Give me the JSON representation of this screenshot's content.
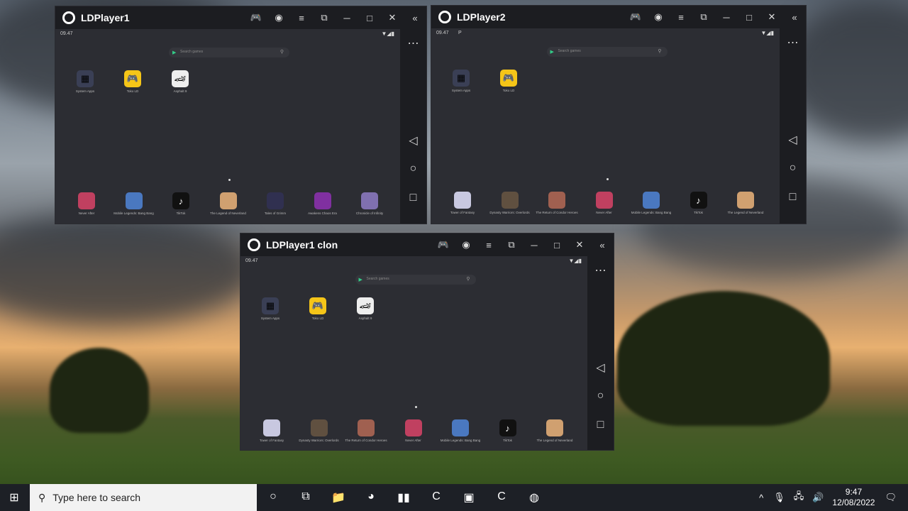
{
  "windows": [
    {
      "title": "LDPlayer1",
      "time": "09.47",
      "status_extra": "",
      "search_placeholder": "Search games",
      "top_apps": [
        {
          "label": "System Apps",
          "icon": "grid-apps-icon",
          "color": "#3a3f55"
        },
        {
          "label": "Toko LD",
          "icon": "gamepad-icon",
          "color": "#f5c518"
        },
        {
          "label": "Asphalt 9",
          "icon": "car-icon",
          "color": "#eeeeee"
        }
      ],
      "dock_apps": [
        {
          "label": "Never After",
          "color": "#c04060"
        },
        {
          "label": "Mobile Legends: Bang Bang",
          "color": "#4a78c0"
        },
        {
          "label": "TikTok",
          "color": "#111111"
        },
        {
          "label": "The Legend of Neverland",
          "color": "#d0a070"
        },
        {
          "label": "Tales of Grimm",
          "color": "#303050"
        },
        {
          "label": "Awakens Chaos Era",
          "color": "#8030a0"
        },
        {
          "label": "Chronicle of Infinity",
          "color": "#8070b0"
        }
      ]
    },
    {
      "title": "LDPlayer2",
      "time": "09.47",
      "status_extra": "P",
      "search_placeholder": "Search games",
      "top_apps": [
        {
          "label": "System Apps",
          "icon": "grid-apps-icon",
          "color": "#3a3f55"
        },
        {
          "label": "Toko LD",
          "icon": "gamepad-icon",
          "color": "#f5c518"
        }
      ],
      "dock_apps": [
        {
          "label": "Tower of Fantasy",
          "color": "#c8c8e0"
        },
        {
          "label": "Dynasty Warriors: Overlords",
          "color": "#605040"
        },
        {
          "label": "The Return of Condor Heroes",
          "color": "#a06050"
        },
        {
          "label": "Never After",
          "color": "#c04060"
        },
        {
          "label": "Mobile Legends: Bang Bang",
          "color": "#4a78c0"
        },
        {
          "label": "TikTok",
          "color": "#111111"
        },
        {
          "label": "The Legend of Neverland",
          "color": "#d0a070"
        }
      ]
    },
    {
      "title": "LDPlayer1 clon",
      "time": "09.47",
      "status_extra": "",
      "search_placeholder": "Search games",
      "top_apps": [
        {
          "label": "System Apps",
          "icon": "grid-apps-icon",
          "color": "#3a3f55"
        },
        {
          "label": "Toko LD",
          "icon": "gamepad-icon",
          "color": "#f5c518"
        },
        {
          "label": "Asphalt 9",
          "icon": "car-icon",
          "color": "#eeeeee"
        }
      ],
      "dock_apps": [
        {
          "label": "Tower of Fantasy",
          "color": "#c8c8e0"
        },
        {
          "label": "Dynasty Warriors: Overlords",
          "color": "#605040"
        },
        {
          "label": "The Return of Condor Heroes",
          "color": "#a06050"
        },
        {
          "label": "Never After",
          "color": "#c04060"
        },
        {
          "label": "Mobile Legends: Bang Bang",
          "color": "#4a78c0"
        },
        {
          "label": "TikTok",
          "color": "#111111"
        },
        {
          "label": "The Legend of Neverland",
          "color": "#d0a070"
        }
      ]
    }
  ],
  "titlebar_buttons": [
    {
      "name": "gamepad",
      "glyph": "🎮"
    },
    {
      "name": "account",
      "glyph": "◉"
    },
    {
      "name": "menu",
      "glyph": "≡"
    },
    {
      "name": "resize",
      "glyph": "⧉"
    },
    {
      "name": "minimize",
      "glyph": "─"
    },
    {
      "name": "maximize",
      "glyph": "□"
    },
    {
      "name": "close",
      "glyph": "✕"
    },
    {
      "name": "collapse-sidebar",
      "glyph": "«"
    }
  ],
  "taskbar": {
    "search_placeholder": "Type here to search",
    "time": "9:47",
    "date": "12/08/2022",
    "apps": [
      {
        "name": "cortana",
        "glyph": "○"
      },
      {
        "name": "task-view",
        "glyph": "⧉"
      },
      {
        "name": "file-explorer",
        "glyph": "📁"
      },
      {
        "name": "chrome",
        "glyph": "◕"
      },
      {
        "name": "audio-app",
        "glyph": "▮▮"
      },
      {
        "name": "camtasia",
        "glyph": "C"
      },
      {
        "name": "ldmultiplayer",
        "glyph": "▣"
      },
      {
        "name": "recorder",
        "glyph": "C"
      },
      {
        "name": "ldplayer",
        "glyph": "◍"
      }
    ]
  }
}
